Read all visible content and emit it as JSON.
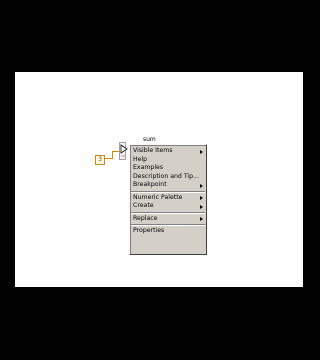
{
  "node": {
    "label": "sum",
    "constant_value": "3"
  },
  "context_menu": {
    "groups": [
      [
        {
          "label": "Visible Items",
          "submenu": true
        },
        {
          "label": "Help",
          "submenu": false
        },
        {
          "label": "Examples",
          "submenu": false
        },
        {
          "label": "Description and Tip...",
          "submenu": false
        },
        {
          "label": "Breakpoint",
          "submenu": true
        }
      ],
      [
        {
          "label": "Numeric Palette",
          "submenu": true
        },
        {
          "label": "Create",
          "submenu": true
        }
      ],
      [
        {
          "label": "Replace",
          "submenu": true
        }
      ],
      [
        {
          "label": "Properties",
          "submenu": false
        }
      ]
    ]
  },
  "icons": {
    "submenu_arrow": "triangle-right-icon",
    "compound_node": "compound-arithmetic-icon"
  },
  "colors": {
    "wire": "#d08a00",
    "menu_background": "#d4d0c8",
    "diagram_background": "#ffffff",
    "frame_background": "#000000"
  }
}
